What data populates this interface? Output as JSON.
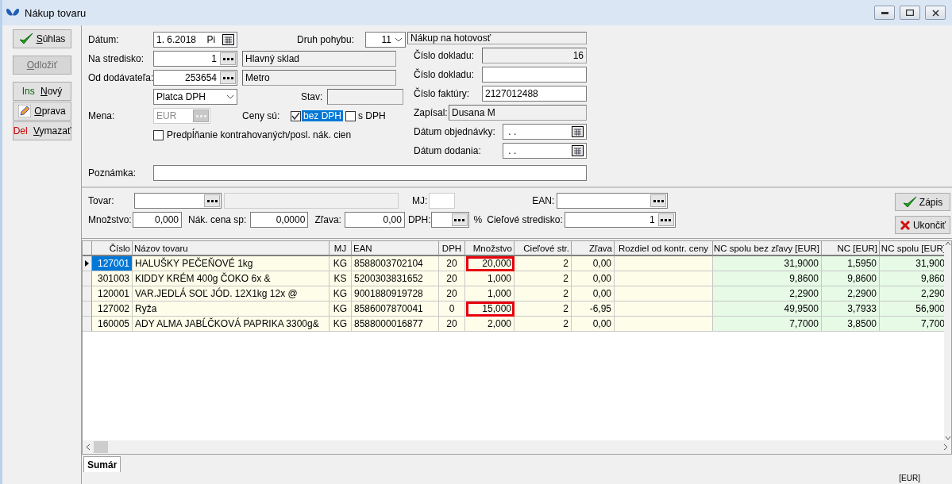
{
  "window": {
    "title": "Nákup tovaru"
  },
  "actions": [
    {
      "label": "Súhlas",
      "kind": "confirm",
      "disabled": false
    },
    {
      "label": "Odložiť",
      "kind": "postpone",
      "disabled": true
    },
    {
      "key": "Ins",
      "kind": "insert",
      "label": "Nový",
      "disabled": false
    },
    {
      "label": "Oprava",
      "kind": "edit",
      "disabled": false
    },
    {
      "key": "Del",
      "kind": "delete",
      "label": "Vymazať",
      "disabled": false
    }
  ],
  "header": {
    "date": {
      "label": "Dátum:",
      "value": "1. 6.2018",
      "day": "Pi"
    },
    "movement": {
      "label": "Druh pohybu:",
      "value": "11",
      "name": "Nákup na hotovosť"
    },
    "center": {
      "label": "Na stredisko:",
      "value": "1",
      "name": "Hlavný sklad"
    },
    "supplier": {
      "label": "Od dodávateľa:",
      "value": "253654",
      "name": "Metro"
    },
    "vat_payer": {
      "value": "Platca DPH"
    },
    "status": {
      "label": "Stav:"
    },
    "currency": {
      "label": "Mena:",
      "value": "EUR",
      "disabled": true
    },
    "prices": {
      "label": "Ceny sú:",
      "options": [
        {
          "label": "bez DPH",
          "checked": true,
          "selected": true
        },
        {
          "label": "s DPH",
          "checked": false,
          "selected": false
        }
      ]
    },
    "prefill": {
      "label": "Predpĺňanie kontrahovaných/posl. nák. cien",
      "checked": false
    },
    "right_fields": [
      {
        "label": "Číslo dokladu:",
        "value": "16",
        "kind": "number",
        "readonly": true
      },
      {
        "label": "Číslo dokladu:",
        "kind": "text",
        "readonly": false
      },
      {
        "label": "Číslo faktúry:",
        "value": "2127012488",
        "kind": "text",
        "readonly": false
      },
      {
        "label": "Zapísal:",
        "value": "Dusana M",
        "kind": "text",
        "readonly": true
      }
    ],
    "dates": [
      {
        "label": "Dátum objednávky:",
        "value": ". ."
      },
      {
        "label": "Dátum dodania:",
        "value": ". ."
      }
    ],
    "note": {
      "label": "Poznámka:"
    }
  },
  "entry": {
    "product": {
      "label": "Tovar:"
    },
    "unit": {
      "label": "MJ:"
    },
    "ean": {
      "label": "EAN:"
    },
    "quantity": {
      "label": "Množstvo:",
      "value": "0,000"
    },
    "price": {
      "label": "Nák. cena sp:",
      "value": "0,0000"
    },
    "discount": {
      "label": "Zľava:",
      "value": "0,00"
    },
    "vat": {
      "label": "DPH:",
      "unit": "%"
    },
    "target": {
      "label": "Cieľové stredisko:",
      "value": "1"
    },
    "buttons": [
      {
        "label": "Zápis",
        "kind": "confirm"
      },
      {
        "label": "Ukončiť",
        "kind": "close"
      }
    ]
  },
  "table": {
    "columns": [
      {
        "label": "Číslo",
        "kind": "number"
      },
      {
        "label": "Názov tovaru",
        "kind": "text"
      },
      {
        "label": "MJ",
        "kind": "center"
      },
      {
        "label": "EAN",
        "kind": "text"
      },
      {
        "label": "DPH",
        "kind": "center"
      },
      {
        "label": "Množstvo",
        "kind": "quantity"
      },
      {
        "label": "Cieľové str.",
        "kind": "number"
      },
      {
        "label": "Zľava",
        "kind": "number"
      },
      {
        "label": "Rozdiel od kontr. ceny",
        "kind": "center"
      },
      {
        "label": "NC spolu bez zľavy [EUR]",
        "kind": "price"
      },
      {
        "label": "NC [EUR]",
        "kind": "price"
      },
      {
        "label": "NC spolu [EUR]",
        "kind": "price"
      }
    ],
    "rows": [
      {
        "selected": true,
        "flagged": true,
        "cells": [
          "127001",
          "HALUŠKY PEČEŇOVÉ  1kg",
          "KG",
          "8588003702104",
          "20",
          "20,000",
          "2",
          "0,00",
          "",
          "31,9000",
          "1,5950",
          "31,900"
        ]
      },
      {
        "selected": false,
        "flagged": false,
        "cells": [
          "301003",
          "KIDDY KRÉM 400g ČOKO 6x         &",
          "KS",
          "5200303831652",
          "20",
          "1,000",
          "2",
          "0,00",
          "",
          "9,8600",
          "9,8600",
          "9,860"
        ]
      },
      {
        "selected": false,
        "flagged": false,
        "cells": [
          "120001",
          "VAR.JEDLÁ SOĽ JÓD. 12X1kg 12x  @",
          "KG",
          "9001880919728",
          "20",
          "1,000",
          "2",
          "0,00",
          "",
          "2,2900",
          "2,2900",
          "2,290"
        ]
      },
      {
        "selected": false,
        "flagged": true,
        "cells": [
          "127002",
          "Ryža",
          "KG",
          "8586007870041",
          "0",
          "15,000",
          "2",
          "-6,95",
          "",
          "49,9500",
          "3,7933",
          "56,900"
        ]
      },
      {
        "selected": false,
        "flagged": false,
        "cells": [
          "160005",
          "ADY ALMA JABĹČKOVÁ PAPRIKA 3300g&",
          "KG",
          "8588000016877",
          "20",
          "2,000",
          "2",
          "0,00",
          "",
          "7,7000",
          "3,8500",
          "7,700"
        ]
      }
    ]
  },
  "tabs": [
    {
      "label": "Sumár",
      "selected": true
    }
  ],
  "footer": {
    "currency": "[EUR]"
  }
}
